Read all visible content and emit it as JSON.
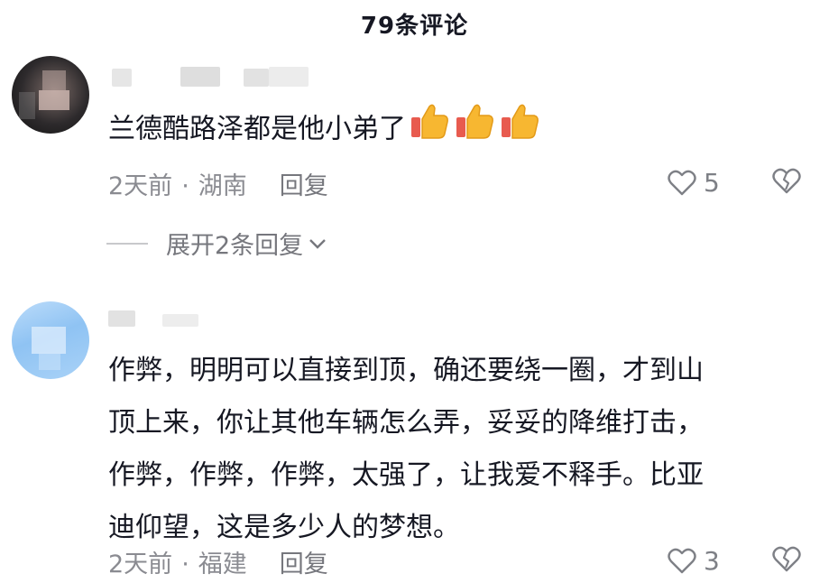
{
  "header": {
    "title": "79条评论"
  },
  "comments": [
    {
      "text": "兰德酷路泽都是他小弟了",
      "emoji_icons": [
        "thumbs-up-icon",
        "thumbs-up-icon",
        "thumbs-up-icon"
      ],
      "time": "2天前",
      "separator": "·",
      "location": "湖南",
      "reply_label": "回复",
      "likes": "5",
      "expand_label": "展开2条回复"
    },
    {
      "lines": [
        "作弊，明明可以直接到顶，确还要绕一圈，才到山",
        "顶上来，你让其他车辆怎么弄，妥妥的降维打击，",
        "作弊，作弊，作弊，太强了，让我爱不释手。比亚",
        "迪仰望，这是多少人的梦想。"
      ],
      "time": "2天前",
      "separator": "·",
      "location": "福建",
      "reply_label": "回复",
      "likes": "3"
    }
  ],
  "colors": {
    "text": "#161823",
    "meta": "#8a8b91",
    "icon": "#7e8086"
  }
}
